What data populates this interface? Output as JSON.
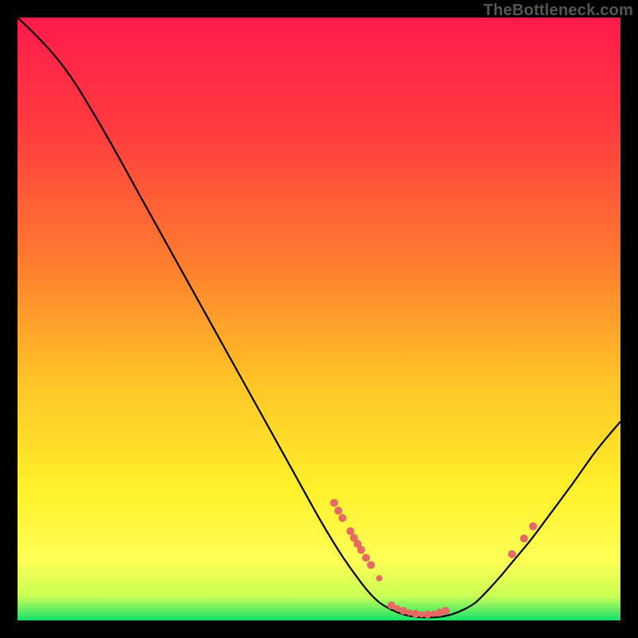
{
  "watermark": "TheBottleneck.com",
  "chart_data": {
    "type": "line",
    "title": "",
    "xlabel": "",
    "ylabel": "",
    "xlim": [
      0,
      100
    ],
    "ylim": [
      0,
      100
    ],
    "gradient_stops": [
      {
        "offset": 0,
        "color": "#ff1b4b"
      },
      {
        "offset": 18,
        "color": "#ff3a3f"
      },
      {
        "offset": 40,
        "color": "#ff7a2e"
      },
      {
        "offset": 60,
        "color": "#ffc327"
      },
      {
        "offset": 78,
        "color": "#fff02a"
      },
      {
        "offset": 90,
        "color": "#ffff55"
      },
      {
        "offset": 96,
        "color": "#c9ff55"
      },
      {
        "offset": 100,
        "color": "#15e06c"
      }
    ],
    "curve": [
      {
        "x": 0.0,
        "y": 100.0
      },
      {
        "x": 2.5,
        "y": 97.6
      },
      {
        "x": 5.0,
        "y": 95.0
      },
      {
        "x": 7.5,
        "y": 92.0
      },
      {
        "x": 10.0,
        "y": 88.4
      },
      {
        "x": 15.0,
        "y": 80.0
      },
      {
        "x": 20.0,
        "y": 71.0
      },
      {
        "x": 25.0,
        "y": 62.0
      },
      {
        "x": 30.0,
        "y": 53.0
      },
      {
        "x": 35.0,
        "y": 44.0
      },
      {
        "x": 40.0,
        "y": 35.0
      },
      {
        "x": 45.0,
        "y": 26.0
      },
      {
        "x": 50.0,
        "y": 17.0
      },
      {
        "x": 53.0,
        "y": 12.0
      },
      {
        "x": 55.0,
        "y": 9.0
      },
      {
        "x": 58.0,
        "y": 5.0
      },
      {
        "x": 60.0,
        "y": 3.0
      },
      {
        "x": 62.0,
        "y": 1.8
      },
      {
        "x": 64.0,
        "y": 1.0
      },
      {
        "x": 66.0,
        "y": 0.6
      },
      {
        "x": 68.0,
        "y": 0.5
      },
      {
        "x": 70.0,
        "y": 0.6
      },
      {
        "x": 72.0,
        "y": 1.0
      },
      {
        "x": 74.0,
        "y": 1.8
      },
      {
        "x": 76.0,
        "y": 3.0
      },
      {
        "x": 78.0,
        "y": 5.0
      },
      {
        "x": 80.0,
        "y": 7.2
      },
      {
        "x": 82.0,
        "y": 9.6
      },
      {
        "x": 85.0,
        "y": 13.2
      },
      {
        "x": 88.0,
        "y": 17.2
      },
      {
        "x": 92.0,
        "y": 22.6
      },
      {
        "x": 96.0,
        "y": 28.2
      },
      {
        "x": 100.0,
        "y": 33.0
      }
    ],
    "markers": [
      {
        "x": 52.5,
        "y": 19.5,
        "r": 5
      },
      {
        "x": 53.2,
        "y": 18.2,
        "r": 5
      },
      {
        "x": 53.9,
        "y": 17.0,
        "r": 5
      },
      {
        "x": 55.2,
        "y": 14.8,
        "r": 5
      },
      {
        "x": 55.8,
        "y": 13.7,
        "r": 5
      },
      {
        "x": 56.4,
        "y": 12.7,
        "r": 5
      },
      {
        "x": 57.0,
        "y": 11.7,
        "r": 5
      },
      {
        "x": 57.8,
        "y": 10.4,
        "r": 5
      },
      {
        "x": 58.6,
        "y": 9.2,
        "r": 5
      },
      {
        "x": 60.0,
        "y": 7.0,
        "r": 4
      },
      {
        "x": 62.0,
        "y": 2.5,
        "r": 5
      },
      {
        "x": 63.0,
        "y": 2.0,
        "r": 4
      },
      {
        "x": 64.0,
        "y": 1.6,
        "r": 5
      },
      {
        "x": 65.0,
        "y": 1.3,
        "r": 4
      },
      {
        "x": 66.0,
        "y": 1.1,
        "r": 5
      },
      {
        "x": 67.0,
        "y": 1.0,
        "r": 4
      },
      {
        "x": 68.0,
        "y": 1.0,
        "r": 5
      },
      {
        "x": 69.0,
        "y": 1.1,
        "r": 4
      },
      {
        "x": 70.0,
        "y": 1.3,
        "r": 5
      },
      {
        "x": 71.0,
        "y": 1.6,
        "r": 5
      },
      {
        "x": 82.0,
        "y": 11.0,
        "r": 5
      },
      {
        "x": 84.0,
        "y": 13.6,
        "r": 5
      },
      {
        "x": 85.5,
        "y": 15.6,
        "r": 5
      }
    ],
    "marker_color": "#e66a63",
    "curve_color": "#000000"
  }
}
